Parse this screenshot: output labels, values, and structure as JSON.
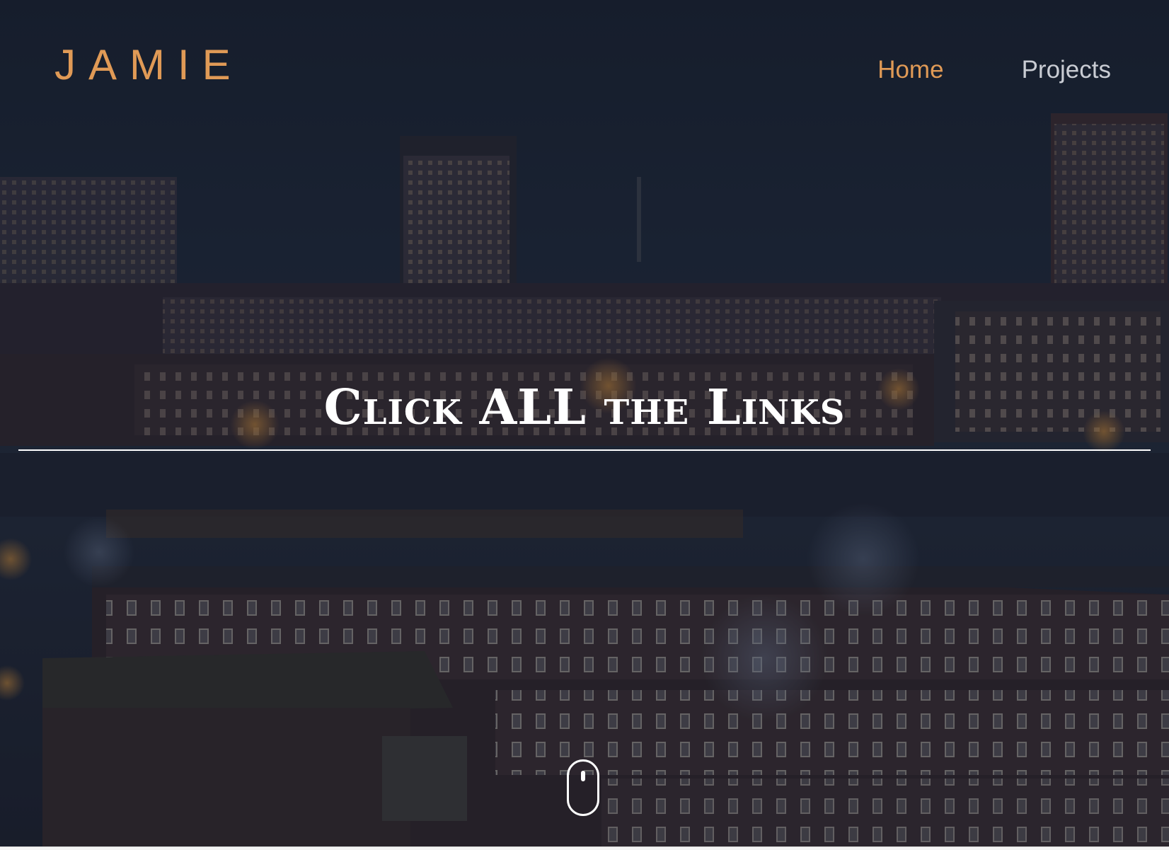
{
  "site": {
    "logo": "JAMIE"
  },
  "nav": {
    "items": [
      {
        "label": "Home",
        "active": true
      },
      {
        "label": "Projects",
        "active": false
      }
    ]
  },
  "hero": {
    "headline": "Click ALL the Links",
    "scroll_indicator": "mouse-scroll-icon"
  },
  "colors": {
    "accent": "#e09a56",
    "nav_text": "#c9ccd3",
    "headline": "#ffffff",
    "overlay": "#1a2030"
  }
}
